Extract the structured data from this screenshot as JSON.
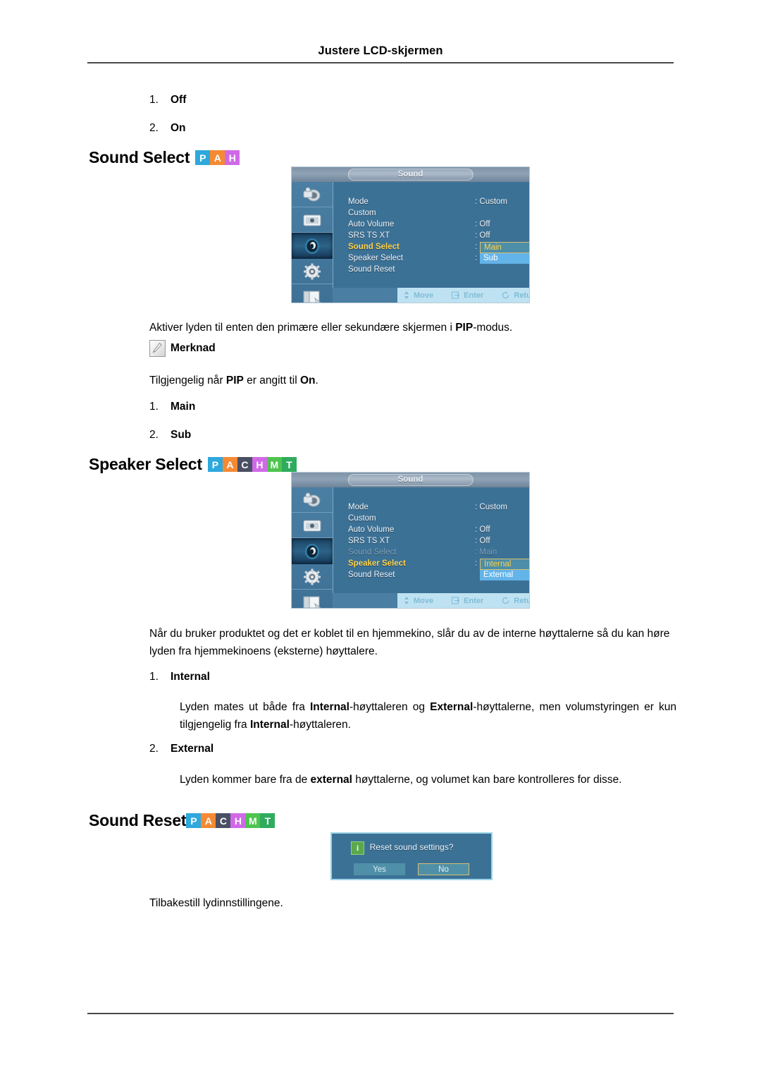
{
  "page": {
    "header_title": "Justere LCD-skjermen"
  },
  "intro_list": [
    {
      "num": "1.",
      "label": "Off"
    },
    {
      "num": "2.",
      "label": "On"
    }
  ],
  "sections": [
    {
      "id": "sound-select",
      "heading": "Sound Select",
      "badges": [
        {
          "letter": "P",
          "color": "#2ea8dd"
        },
        {
          "letter": "A",
          "color": "#f58a33"
        },
        {
          "letter": "H",
          "color": "#d069e8"
        }
      ],
      "osd": {
        "title": "Sound",
        "rows": [
          {
            "label": "Mode",
            "value": ": Custom",
            "state": "normal"
          },
          {
            "label": "Custom",
            "value": "",
            "state": "normal"
          },
          {
            "label": "Auto Volume",
            "value": ": Off",
            "state": "normal"
          },
          {
            "label": "SRS TS XT",
            "value": ": Off",
            "state": "normal"
          },
          {
            "label": "Sound Select",
            "value": ":",
            "state": "highlight"
          },
          {
            "label": "Speaker Select",
            "value": ":",
            "state": "normal"
          },
          {
            "label": "Sound Reset",
            "value": "",
            "state": "normal"
          }
        ],
        "dropdown": {
          "active": "Main",
          "inactive": "Sub",
          "row_index": 4
        },
        "footer": [
          {
            "icon": "move-icon",
            "label": "Move"
          },
          {
            "icon": "enter-icon",
            "label": "Enter"
          },
          {
            "icon": "return-icon",
            "label": "Return"
          }
        ]
      },
      "description": "Aktiver lyden til enten den primære eller sekundære skjermen i <b>PIP</b>-modus.",
      "note": {
        "icon": "note-pencil-icon",
        "label": "Merknad",
        "text": "Tilgjengelig når <b>PIP</b> er angitt til <b>On</b>."
      },
      "items": [
        {
          "num": "1.",
          "label": "Main"
        },
        {
          "num": "2.",
          "label": "Sub"
        }
      ]
    },
    {
      "id": "speaker-select",
      "heading": "Speaker Select",
      "badges": [
        {
          "letter": "P",
          "color": "#2ea8dd"
        },
        {
          "letter": "A",
          "color": "#f58a33"
        },
        {
          "letter": "C",
          "color": "#4b4f63"
        },
        {
          "letter": "H",
          "color": "#d069e8"
        },
        {
          "letter": "M",
          "color": "#4ec44e"
        },
        {
          "letter": "T",
          "color": "#2fab5e"
        }
      ],
      "osd": {
        "title": "Sound",
        "rows": [
          {
            "label": "Mode",
            "value": ": Custom",
            "state": "normal"
          },
          {
            "label": "Custom",
            "value": "",
            "state": "normal"
          },
          {
            "label": "Auto Volume",
            "value": ": Off",
            "state": "normal"
          },
          {
            "label": "SRS TS XT",
            "value": ": Off",
            "state": "normal"
          },
          {
            "label": "Sound Select",
            "value": ": Main",
            "state": "dim"
          },
          {
            "label": "Speaker Select",
            "value": ":",
            "state": "highlight"
          },
          {
            "label": "Sound Reset",
            "value": "",
            "state": "normal"
          }
        ],
        "dropdown": {
          "active": "Internal",
          "inactive": "External",
          "row_index": 5
        },
        "footer": [
          {
            "icon": "move-icon",
            "label": "Move"
          },
          {
            "icon": "enter-icon",
            "label": "Enter"
          },
          {
            "icon": "return-icon",
            "label": "Return"
          }
        ]
      },
      "description": "Når du bruker produktet og det er koblet til en hjemmekino, slår du av de interne høyttalerne så du kan høre lyden fra hjemmekinoens (eksterne) høyttalere.",
      "items": [
        {
          "num": "1.",
          "label": "Internal",
          "body": "Lyden mates ut både fra <b>Internal</b>-høyttaleren og <b>External</b>-høyttalerne, men volumstyringen er kun tilgjengelig fra <b>Internal</b>-høyttaleren."
        },
        {
          "num": "2.",
          "label": "External",
          "body": "Lyden kommer bare fra de <b>external</b> høyttalerne, og volumet kan bare kontrolleres for disse."
        }
      ]
    },
    {
      "id": "sound-reset",
      "heading": "Sound Reset",
      "badges": [
        {
          "letter": "P",
          "color": "#2ea8dd"
        },
        {
          "letter": "A",
          "color": "#f58a33"
        },
        {
          "letter": "C",
          "color": "#4b4f63"
        },
        {
          "letter": "H",
          "color": "#d069e8"
        },
        {
          "letter": "M",
          "color": "#4ec44e"
        },
        {
          "letter": "T",
          "color": "#2fab5e"
        }
      ],
      "dialog": {
        "icon": "info-icon",
        "message": "Reset sound settings?",
        "yes_label": "Yes",
        "no_label": "No",
        "focused": "No"
      },
      "description": "Tilbakestill lydinnstillingene."
    }
  ],
  "osd_sidebar_icons": [
    "input-source-icon",
    "picture-icon",
    "sound-icon",
    "setup-gear-icon",
    "multi-control-icon"
  ],
  "colors": {
    "osd_background": "#3c7196",
    "osd_sidebar": "#4a7ea2",
    "highlight_text": "#ffd24a",
    "dropdown_inactive": "#63b4e8",
    "footer_bar": "#bfe2f2"
  }
}
